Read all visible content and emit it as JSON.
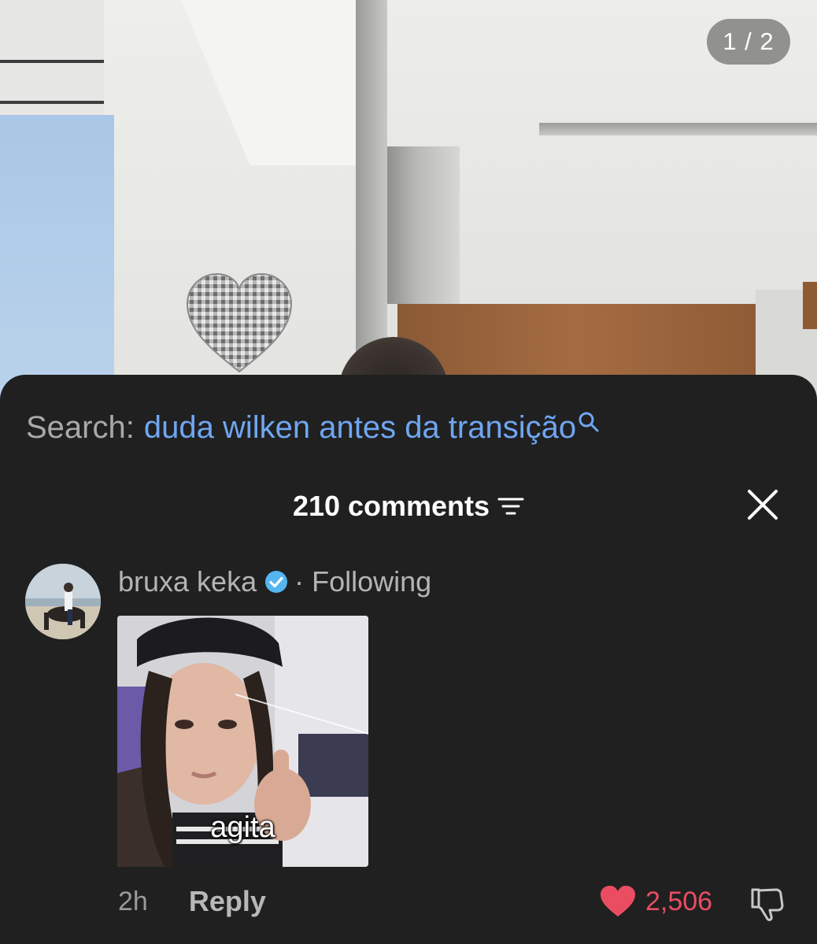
{
  "media": {
    "page_indicator": "1 / 2"
  },
  "search": {
    "prefix": "Search:",
    "query": "duda wilken antes da transição"
  },
  "comments_header": {
    "count_label": "210 comments"
  },
  "comment": {
    "username": "bruxa keka",
    "separator": "·",
    "relation": "Following",
    "sticker_caption": "agita",
    "time": "2h",
    "reply_label": "Reply",
    "like_count": "2,506"
  },
  "colors": {
    "sheet_bg": "#202020",
    "search_link": "#6fa6f0",
    "like_red": "#ea4d62",
    "verified_blue": "#54b5f0"
  },
  "icons": {
    "search": "search-icon",
    "filter": "filter-icon",
    "close": "close-icon",
    "verified": "verified-badge-icon",
    "like": "heart-icon",
    "dislike": "thumbs-down-icon"
  }
}
